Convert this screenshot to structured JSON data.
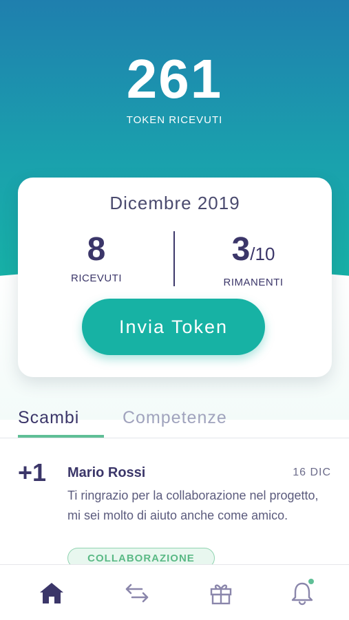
{
  "summary": {
    "total": "261",
    "total_label": "TOKEN RICEVUTI"
  },
  "card": {
    "month": "Dicembre 2019",
    "received": {
      "value": "8",
      "label": "RICEVUTI"
    },
    "remaining": {
      "value": "3",
      "total": "/10",
      "label": "RIMANENTI"
    },
    "send_button": "Invia Token"
  },
  "tabs": [
    {
      "label": "Scambi",
      "active": true
    },
    {
      "label": "Competenze",
      "active": false
    }
  ],
  "exchanges": [
    {
      "delta": "+1",
      "name": "Mario Rossi",
      "date": "16 DIC",
      "message": "Ti ringrazio per la collaborazione nel progetto, mi sei molto di aiuto anche come amico.",
      "tag": "COLLABORAZIONE"
    }
  ],
  "bottom_nav": [
    {
      "icon": "home-icon",
      "active": true
    },
    {
      "icon": "exchange-icon",
      "active": false
    },
    {
      "icon": "gift-icon",
      "active": false
    },
    {
      "icon": "bell-icon",
      "active": false,
      "has_notification": true
    }
  ],
  "colors": {
    "primary": "#3b3669",
    "accent": "#17b2a4",
    "tab_underline": "#5fbf96",
    "notification": "#5fbf96",
    "icon_inactive": "#8a86ab"
  }
}
